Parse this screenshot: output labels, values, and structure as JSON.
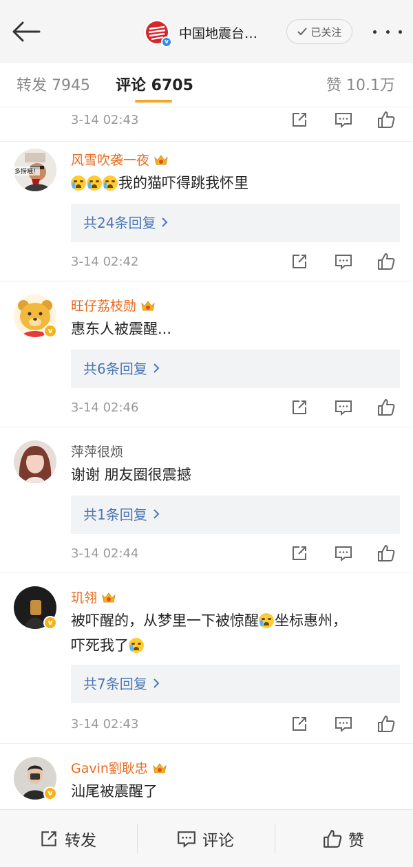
{
  "header": {
    "title": "中国地震台…",
    "follow_label": "已关注"
  },
  "tabs": [
    {
      "label": "转发 7945"
    },
    {
      "label": "评论 6705"
    },
    {
      "label": "赞 10.1万"
    }
  ],
  "top_meta": {
    "time": "3-14 02:43"
  },
  "comments": [
    {
      "name": "风雪吹袭一夜",
      "avatar_text": "多捞哦！",
      "text": "我的猫吓得跳我怀里",
      "emoji_count": 3,
      "reply_label": "共24条回复",
      "time": "3-14 02:42"
    },
    {
      "name": "旺仔荔枝勋",
      "text": "惠东人被震醒...",
      "reply_label": "共6条回复",
      "time": "3-14 02:46"
    },
    {
      "name": "萍萍很烦",
      "text": "谢谢 朋友圈很震撼",
      "reply_label": "共1条回复",
      "time": "3-14 02:44"
    },
    {
      "name": "玑翎",
      "text_part1": "被吓醒的，从梦里一下被惊醒",
      "text_part2": "坐标惠州，",
      "text_part3": "吓死我了",
      "reply_label": "共7条回复",
      "time": "3-14 02:43"
    },
    {
      "name": "Gavin劉耿忠",
      "text": "汕尾被震醒了"
    }
  ],
  "bottombar": {
    "repost": "转发",
    "comment": "评论",
    "like": "赞"
  },
  "colors": {
    "accent": "#f5a623",
    "name_orange": "#e86b1f",
    "reply_link": "#4a77b6",
    "verified_blue": "#2d8ce8",
    "verified_gold": "#f5b21a"
  }
}
